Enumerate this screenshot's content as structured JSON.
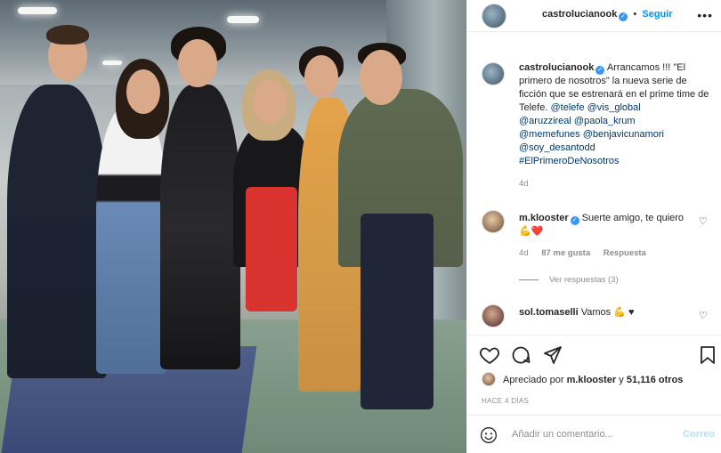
{
  "post": {
    "username": "castrolucianook",
    "follow_sep": "•",
    "follow_label": "Seguir",
    "caption_user": "castrolucianook",
    "caption_text_1": "Arrancamos !!! \"El primero de nosotros\" la nueva serie de ficción que se estrenará en el prime time de Telefe.",
    "mentions": [
      "@telefe",
      "@vis_global",
      "@aruzzireal",
      "@paola_krum",
      "@memefunes",
      "@benjavicunamori",
      "@soy_desantodd",
      "#ElPrimeroDeNosotros"
    ],
    "caption_age": "4d"
  },
  "comments": [
    {
      "user": "m.klooster",
      "text": "Suerte amigo, te quiero",
      "emoji": "💪❤️",
      "age": "4d",
      "likes": "87 me gusta",
      "reply": "Respuesta",
      "view_replies": "Ver respuestas (3)"
    },
    {
      "user": "sol.tomaselli",
      "text": "Vamos",
      "emoji": "💪 ♥"
    }
  ],
  "likes": {
    "prefix": "Apreciado por",
    "user": "m.klooster",
    "connector": "y",
    "others": "51,116 otros"
  },
  "post_age": "HACE 4 DÍAS",
  "add_comment": {
    "placeholder": "Añadir un comentario...",
    "post_label": "Correo"
  },
  "icons": [
    "more-icon",
    "heart-icon",
    "comment-icon",
    "share-icon",
    "bookmark-icon",
    "emoji-icon",
    "verified-icon"
  ],
  "colors": {
    "accent": "#0095f6",
    "verified": "#3897f0",
    "muted": "#8e8e8e",
    "mention": "#00376b",
    "heart_red": "#ed4956"
  }
}
